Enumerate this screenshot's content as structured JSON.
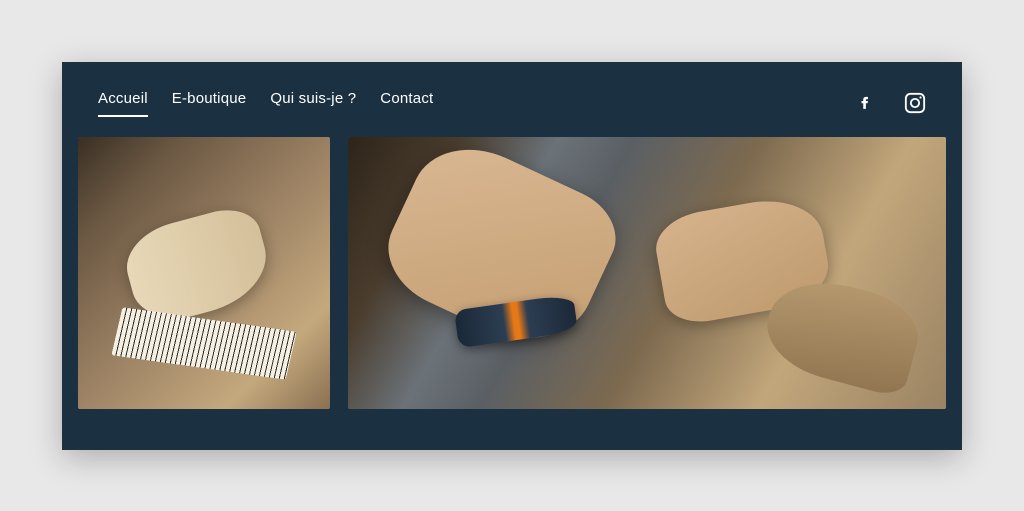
{
  "nav": {
    "items": [
      {
        "label": "Accueil",
        "active": true
      },
      {
        "label": "E-boutique",
        "active": false
      },
      {
        "label": "Qui suis-je ?",
        "active": false
      },
      {
        "label": "Contact",
        "active": false
      }
    ]
  },
  "social": {
    "facebook": "facebook-icon",
    "instagram": "instagram-icon"
  },
  "gallery": {
    "images": [
      {
        "alt": "Hands measuring leather sandal strap with tape measure",
        "size": "small"
      },
      {
        "alt": "Craftsman using rotary tool on leather sandals at workbench",
        "size": "large"
      }
    ]
  }
}
